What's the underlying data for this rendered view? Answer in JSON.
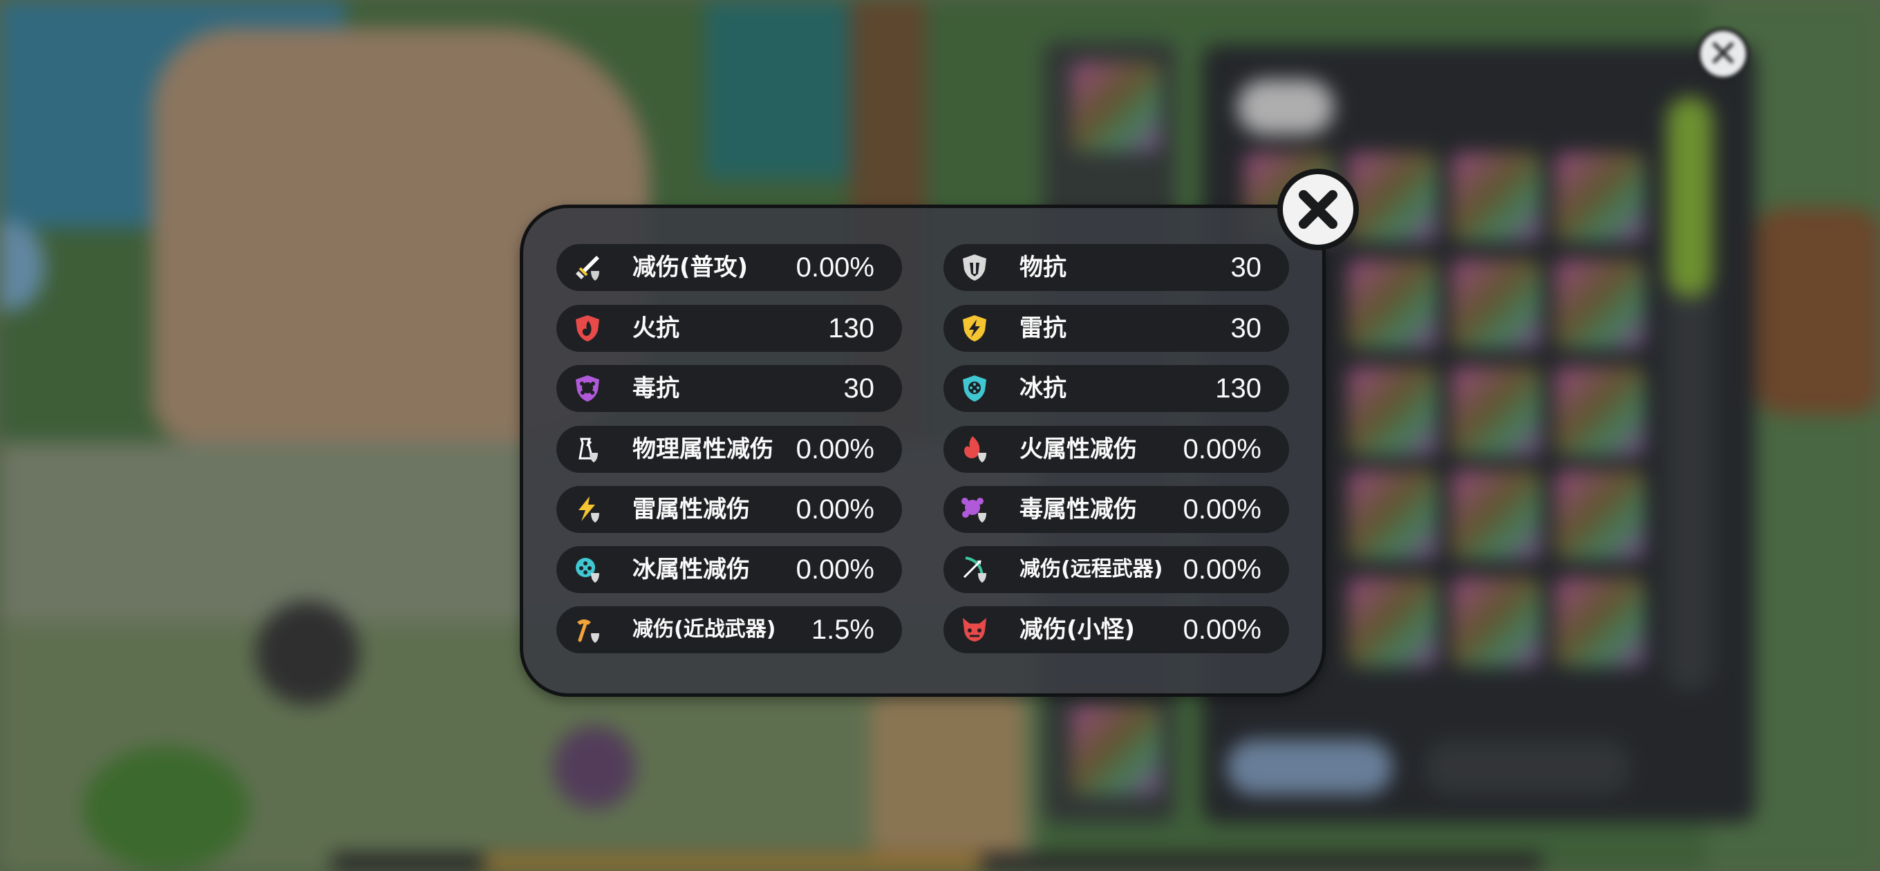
{
  "stats_panel": {
    "left_column": [
      {
        "icon": "sword-shield-icon",
        "label": "减伤(普攻)",
        "value": "0.00%"
      },
      {
        "icon": "fire-shield-icon",
        "label": "火抗",
        "value": "130"
      },
      {
        "icon": "poison-shield-icon",
        "label": "毒抗",
        "value": "30"
      },
      {
        "icon": "physical-damage-reduction-icon",
        "label": "物理属性减伤",
        "value": "0.00%"
      },
      {
        "icon": "lightning-damage-reduction-icon",
        "label": "雷属性减伤",
        "value": "0.00%"
      },
      {
        "icon": "ice-damage-reduction-icon",
        "label": "冰属性减伤",
        "value": "0.00%"
      },
      {
        "icon": "melee-weapon-icon",
        "label": "减伤(近战武器)",
        "value": "1.5%"
      }
    ],
    "right_column": [
      {
        "icon": "physical-shield-icon",
        "label": "物抗",
        "value": "30"
      },
      {
        "icon": "lightning-shield-icon",
        "label": "雷抗",
        "value": "30"
      },
      {
        "icon": "ice-shield-icon",
        "label": "冰抗",
        "value": "130"
      },
      {
        "icon": "fire-damage-reduction-icon",
        "label": "火属性减伤",
        "value": "0.00%"
      },
      {
        "icon": "poison-damage-reduction-icon",
        "label": "毒属性减伤",
        "value": "0.00%"
      },
      {
        "icon": "ranged-weapon-icon",
        "label": "减伤(远程武器)",
        "value": "0.00%"
      },
      {
        "icon": "minion-icon",
        "label": "减伤(小怪)",
        "value": "0.00%"
      }
    ]
  },
  "colors": {
    "panel_bg": "#3a3c42",
    "row_bg": "#1f2024",
    "fire": "#e84a4a",
    "lightning": "#f5c531",
    "poison": "#b05ad9",
    "ice": "#3fc7d2",
    "physical": "#d9d9d9",
    "scroll_accent": "#8fbf3a"
  }
}
